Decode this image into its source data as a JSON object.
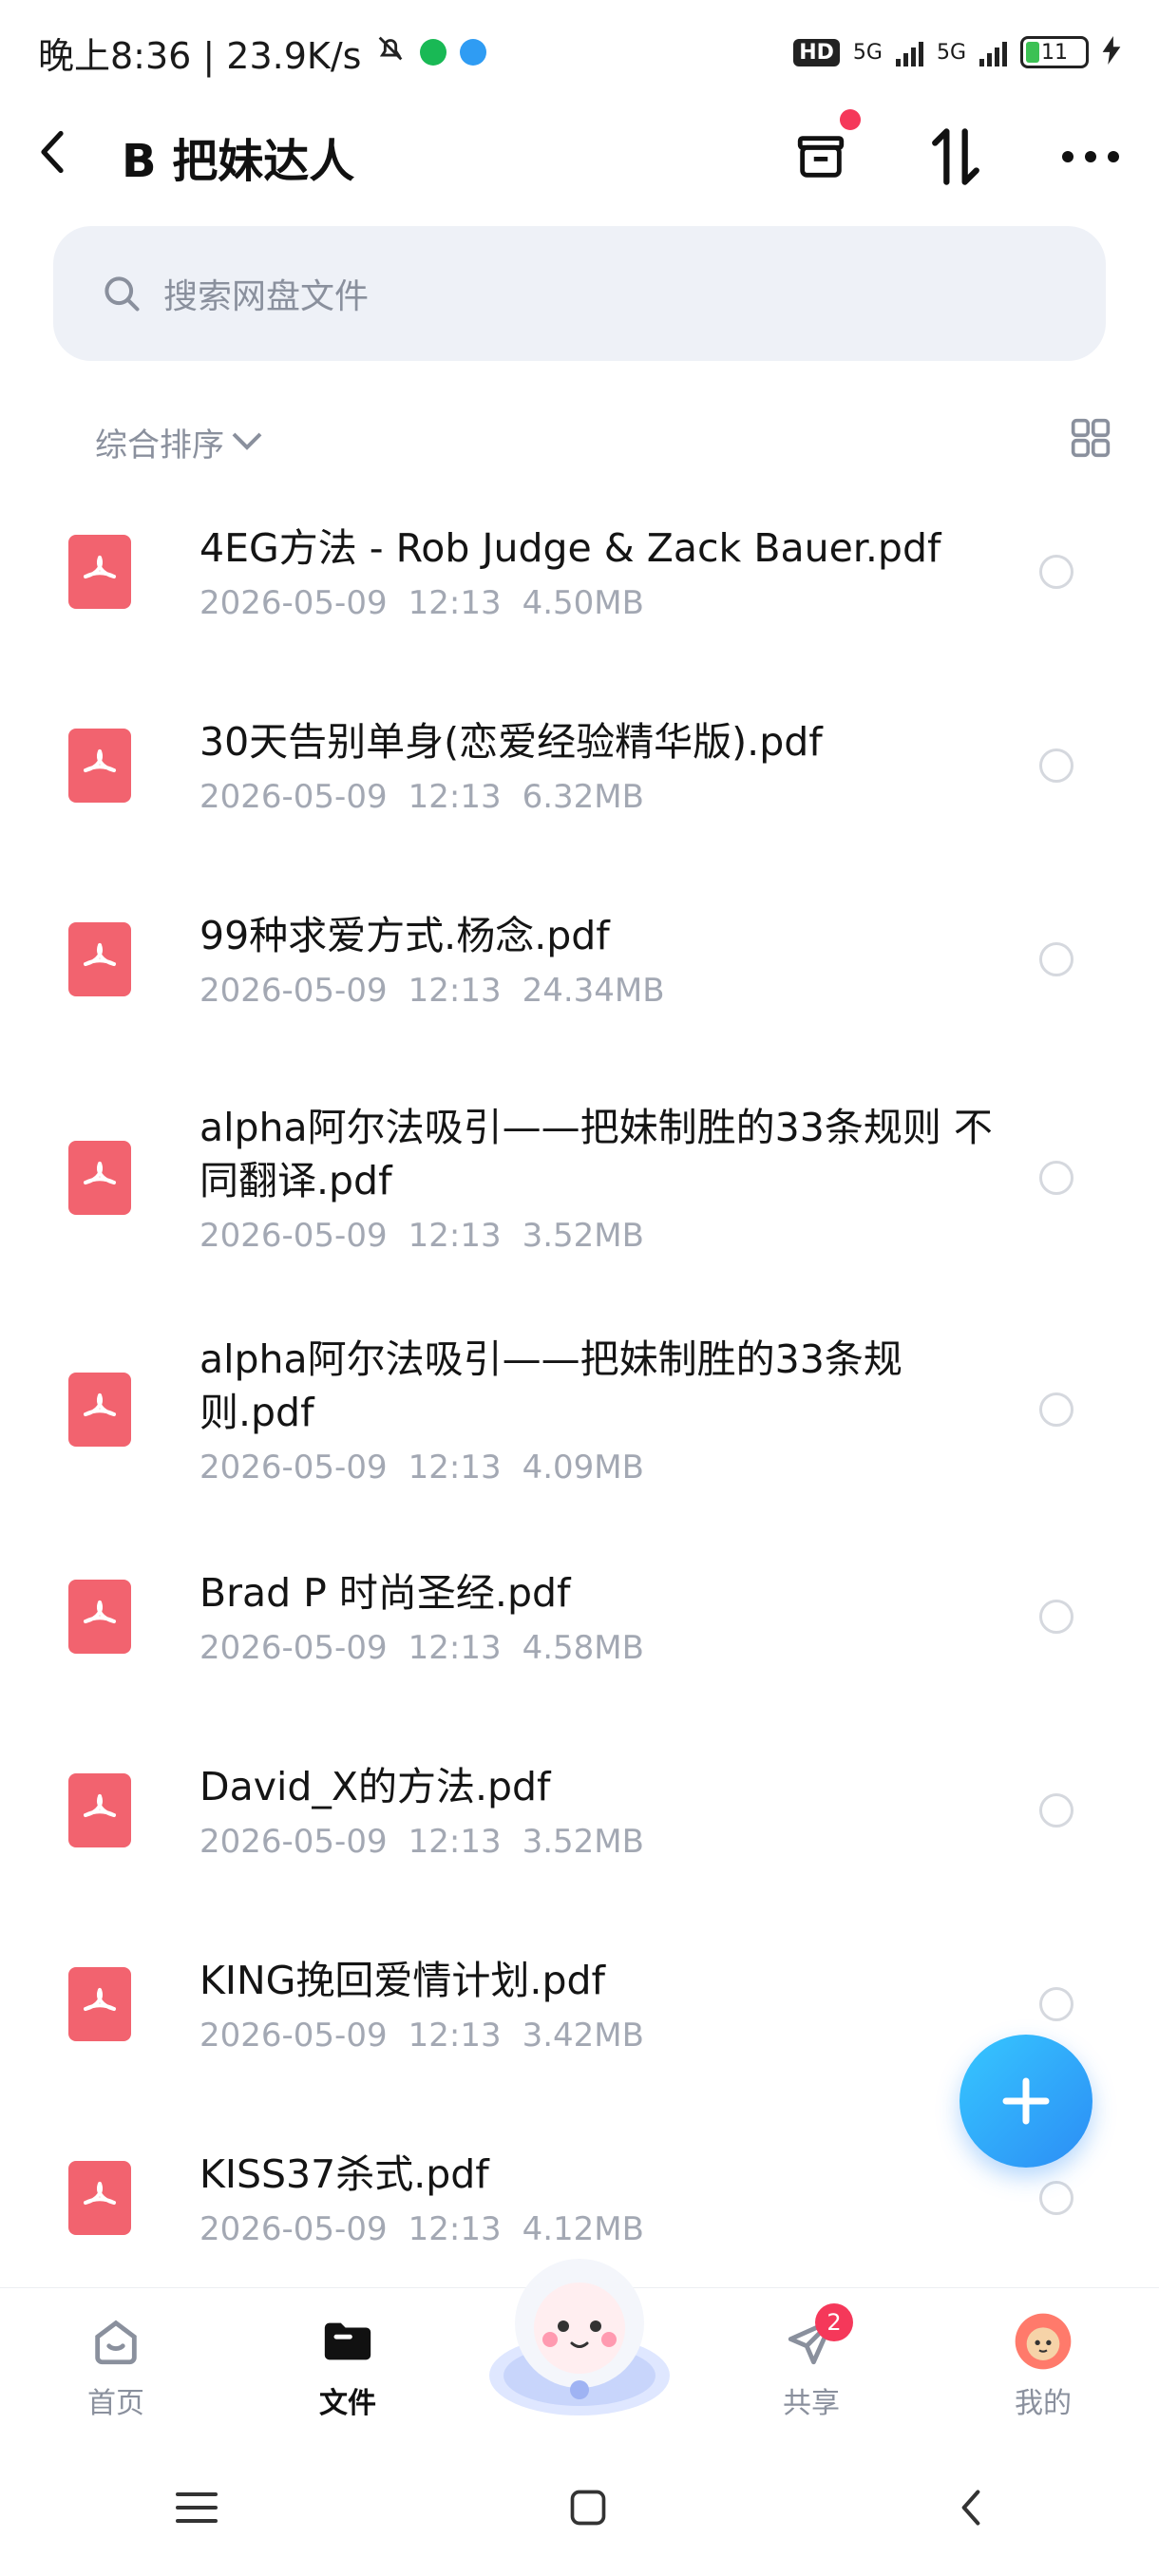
{
  "status_bar": {
    "time_text": "晚上8:36 | 23.9K/s",
    "signal1": "5G",
    "signal2": "5G",
    "battery": "11",
    "hd": "HD"
  },
  "nav": {
    "title": "B 把妹达人"
  },
  "search": {
    "placeholder": "搜索网盘文件"
  },
  "sort": {
    "label": "综合排序"
  },
  "files": [
    {
      "name": "4EG方法 - Rob Judge & Zack Bauer.pdf",
      "date": "2026-05-09",
      "time": "12:13",
      "size": "4.50MB"
    },
    {
      "name": "30天告别单身(恋爱经验精华版).pdf",
      "date": "2026-05-09",
      "time": "12:13",
      "size": "6.32MB"
    },
    {
      "name": "99种求爱方式.杨念.pdf",
      "date": "2026-05-09",
      "time": "12:13",
      "size": "24.34MB"
    },
    {
      "name": "alpha阿尔法吸引——把妹制胜的33条规则 不同翻译.pdf",
      "date": "2026-05-09",
      "time": "12:13",
      "size": "3.52MB"
    },
    {
      "name": "alpha阿尔法吸引——把妹制胜的33条规则.pdf",
      "date": "2026-05-09",
      "time": "12:13",
      "size": "4.09MB"
    },
    {
      "name": "Brad P 时尚圣经.pdf",
      "date": "2026-05-09",
      "time": "12:13",
      "size": "4.58MB"
    },
    {
      "name": "David_X的方法.pdf",
      "date": "2026-05-09",
      "time": "12:13",
      "size": "3.52MB"
    },
    {
      "name": "KING挽回爱情计划.pdf",
      "date": "2026-05-09",
      "time": "12:13",
      "size": "3.42MB"
    },
    {
      "name": "KISS37杀式.pdf",
      "date": "2026-05-09",
      "time": "12:13",
      "size": "4.12MB"
    }
  ],
  "tabs": {
    "home": "首页",
    "files": "文件",
    "share": "共享",
    "share_badge": "2",
    "mine": "我的"
  },
  "colors": {
    "pdf": "#f2636f",
    "accent": "#2c8df5",
    "badge": "#f5385a"
  },
  "icons": {
    "back": "chevron-left-icon",
    "trash": "archive-icon",
    "sort_order": "sort-arrows-icon",
    "more": "more-dots-icon",
    "search": "search-icon",
    "grid": "grid-view-icon",
    "file": "pdf-file-icon",
    "fab": "plus-icon"
  }
}
